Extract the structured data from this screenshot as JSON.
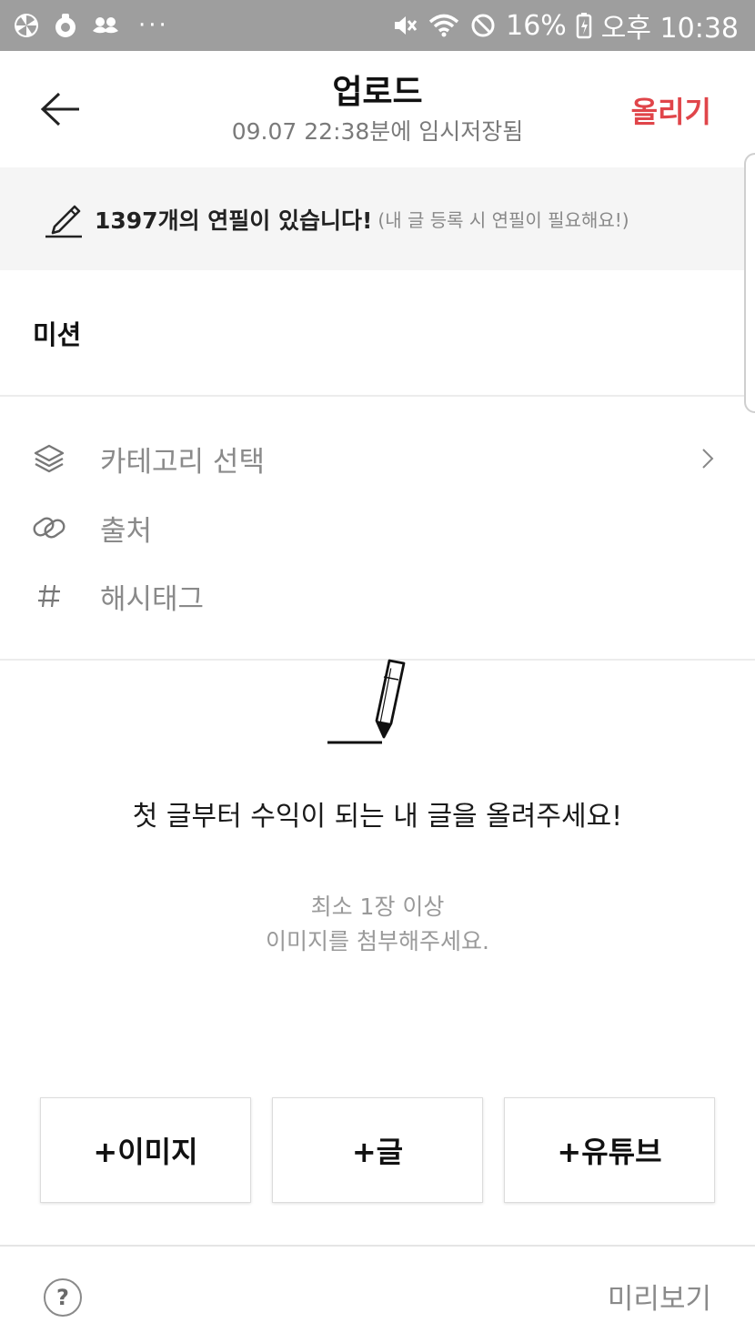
{
  "status_bar": {
    "left_icons": [
      "pinwheel-icon",
      "app-icon",
      "mustache-icon"
    ],
    "more": "···",
    "battery": "16%",
    "time": "오후 10:38",
    "right_icons": [
      "vibrate-icon",
      "wifi-icon",
      "do-not-disturb-icon",
      "battery-icon"
    ]
  },
  "header": {
    "back_icon": "arrow-left-icon",
    "title": "업로드",
    "subtitle": "09.07 22:38분에 임시저장됨",
    "upload_label": "올리기"
  },
  "banner": {
    "icon": "pencil-icon",
    "strong": "1397개의 연필이 있습니다!",
    "note": "(내 글 등록 시 연필이 필요해요!)"
  },
  "mission": {
    "title": "미션"
  },
  "options": [
    {
      "icon": "layers-icon",
      "label": "카테고리 선택",
      "chevron": true
    },
    {
      "icon": "link-icon",
      "label": "출처",
      "chevron": false
    },
    {
      "icon": "hashtag-icon",
      "label": "해시태그",
      "chevron": false
    }
  ],
  "empty_state": {
    "icon": "pencil-writing-icon",
    "main": "첫 글부터 수익이 되는 내 글을 올려주세요!",
    "sub_line1": "최소 1장 이상",
    "sub_line2": "이미지를 첨부해주세요."
  },
  "add_buttons": [
    {
      "label": "+이미지"
    },
    {
      "label": "+글"
    },
    {
      "label": "+유튜브"
    }
  ],
  "footer": {
    "help_icon": "question-circle-icon",
    "help_symbol": "?",
    "preview_label": "미리보기"
  },
  "colors": {
    "accent": "#e0454a",
    "status_bar_bg": "#9e9e9e",
    "banner_bg": "#f5f5f5",
    "muted_text": "#8a8a8a"
  }
}
